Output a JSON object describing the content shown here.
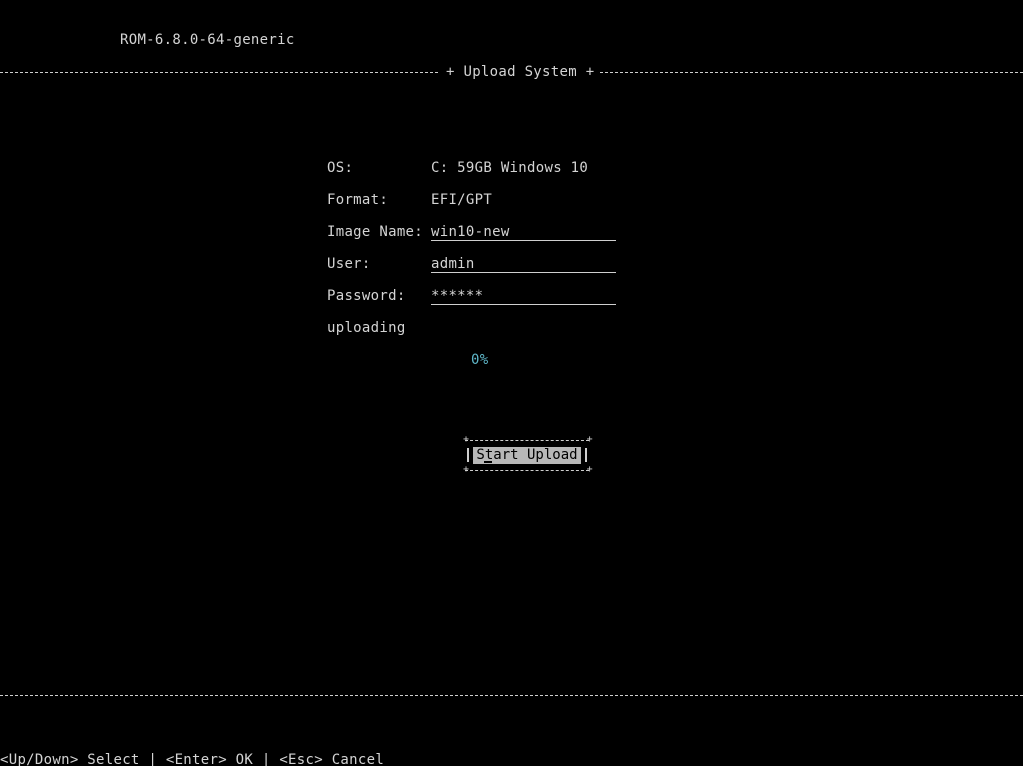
{
  "header": {
    "version": "ROM-6.8.0-64-generic",
    "title": "Upload System",
    "title_left_glyph": "+",
    "title_right_glyph": "+"
  },
  "form": {
    "os_label": "OS:",
    "os_value": "C: 59GB Windows 10",
    "format_label": "Format:",
    "format_value": "EFI/GPT",
    "image_name_label": "Image Name:",
    "image_name_value": "win10-new",
    "user_label": "User:",
    "user_value": "admin",
    "password_label": "Password:",
    "password_value": "******",
    "status_label": "uploading"
  },
  "progress": {
    "text": "0%",
    "value": 0,
    "color": "#5fb7c9"
  },
  "actions": {
    "start_upload_label": "Start Upload"
  },
  "footer": {
    "hints": "<Up/Down> Select | <Enter> OK | <Esc> Cancel"
  },
  "colors": {
    "background": "#000000",
    "text": "#d4d4d4",
    "button_bg": "#b8b8b8",
    "accent": "#5fb7c9"
  }
}
